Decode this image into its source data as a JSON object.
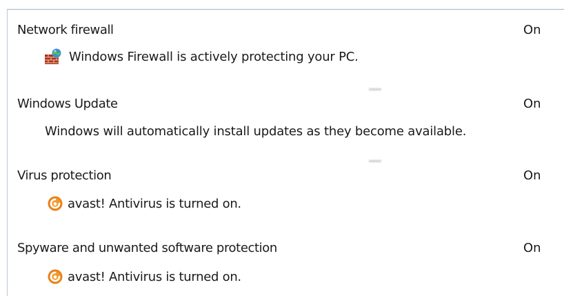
{
  "sections": [
    {
      "heading": "Network firewall",
      "status": "On",
      "detail": "Windows Firewall is actively protecting your PC.",
      "icon": "firewall-icon"
    },
    {
      "heading": "Windows Update",
      "status": "On",
      "detail": "Windows will automatically install updates as they become available.",
      "icon": ""
    },
    {
      "heading": "Virus protection",
      "status": "On",
      "detail": "avast! Antivirus is turned on.",
      "icon": "avast-icon"
    },
    {
      "heading": "Spyware and unwanted software protection",
      "status": "On",
      "detail": "avast! Antivirus is turned on.",
      "icon": "avast-icon"
    }
  ],
  "colors": {
    "border": "#9fb1c9",
    "avast_orange": "#e8801c",
    "firewall_brick": "#b03a1a"
  }
}
